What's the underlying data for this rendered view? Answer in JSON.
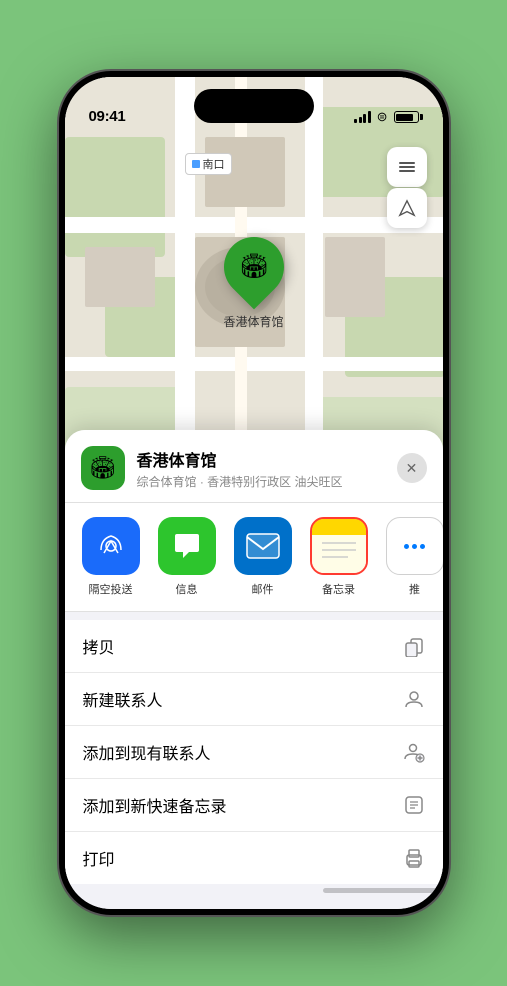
{
  "status_bar": {
    "time": "09:41",
    "location_arrow": "▲"
  },
  "map": {
    "label_text": "南口",
    "map_btn_layers": "🗺",
    "map_btn_location": "➤",
    "stadium_label": "香港体育馆",
    "stadium_emoji": "🏟"
  },
  "venue_card": {
    "venue_name": "香港体育馆",
    "venue_desc": "综合体育馆 · 香港特别行政区 油尖旺区",
    "close_label": "✕",
    "venue_emoji": "🏟"
  },
  "share_items": [
    {
      "id": "airdrop",
      "label": "隔空投送",
      "type": "airdrop"
    },
    {
      "id": "messages",
      "label": "信息",
      "type": "messages"
    },
    {
      "id": "mail",
      "label": "邮件",
      "type": "mail"
    },
    {
      "id": "notes",
      "label": "备忘录",
      "type": "notes",
      "selected": true
    },
    {
      "id": "more",
      "label": "推",
      "type": "more"
    }
  ],
  "action_items": [
    {
      "id": "copy",
      "label": "拷贝",
      "icon": "📋"
    },
    {
      "id": "new-contact",
      "label": "新建联系人",
      "icon": "👤"
    },
    {
      "id": "add-existing",
      "label": "添加到现有联系人",
      "icon": "👤+"
    },
    {
      "id": "add-notes",
      "label": "添加到新快速备忘录",
      "icon": "📝"
    },
    {
      "id": "print",
      "label": "打印",
      "icon": "🖨"
    }
  ]
}
